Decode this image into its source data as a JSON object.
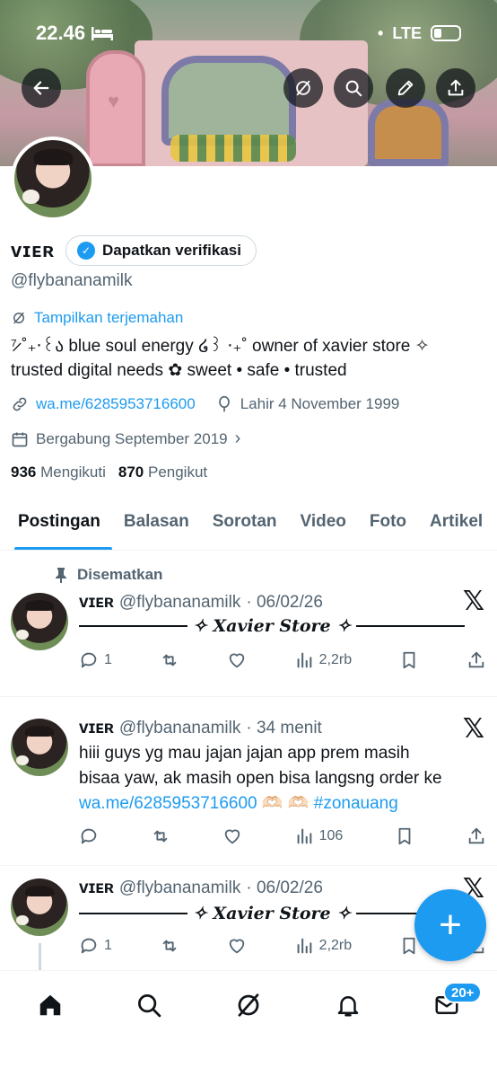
{
  "status": {
    "time": "22.46",
    "network": "LTE"
  },
  "profile": {
    "display_name": "ᴠɪᴇʀ",
    "verify_label": "Dapatkan verifikasi",
    "handle": "@flybananamilk",
    "translate_label": "Tampilkan terjemahan",
    "bio_line1": "⁷̷ ˚₊‧꒰ა blue soul energy ໒꒱ ‧₊˚ owner of xavier store ✧",
    "bio_line2": "trusted digital needs ✿ sweet • safe • trusted",
    "link": "wa.me/6285953716600",
    "birthday": "Lahir 4 November 1999",
    "joined": "Bergabung September 2019",
    "following_count": "936",
    "following_label": "Mengikuti",
    "followers_count": "870",
    "followers_label": "Pengikut"
  },
  "tabs": [
    "Postingan",
    "Balasan",
    "Sorotan",
    "Video",
    "Foto",
    "Artikel"
  ],
  "pinned_label": "Disematkan",
  "posts": [
    {
      "name": "ᴠɪᴇʀ",
      "handle": "@flybananamilk",
      "time": "· 06/02/26",
      "store_text": "✧ Xavier Store ✧",
      "replies": "1",
      "views": "2,2rb"
    },
    {
      "name": "ᴠɪᴇʀ",
      "handle": "@flybananamilk",
      "time": "· 34 menit",
      "text_line1": "hiii guys yg mau jajan jajan app prem masih",
      "text_line2": "bisaa yaw, ak masih open bisa langsng order ke",
      "text_link": "wa.me/6285953716600",
      "text_emoji": " 🫶🏻 🫶🏻 ",
      "text_hashtag": "#zonauang",
      "views": "106"
    },
    {
      "name": "ᴠɪᴇʀ",
      "handle": "@flybananamilk",
      "time": "· 06/02/26",
      "store_text": "✧ Xavier Store ✧",
      "replies": "1",
      "views": "2,2rb"
    }
  ],
  "x_logo": "𝕏",
  "fab_label": "+",
  "notif_badge": "20+",
  "colors": {
    "accent": "#1d9bf0",
    "text": "#0f1419",
    "muted": "#536471"
  }
}
